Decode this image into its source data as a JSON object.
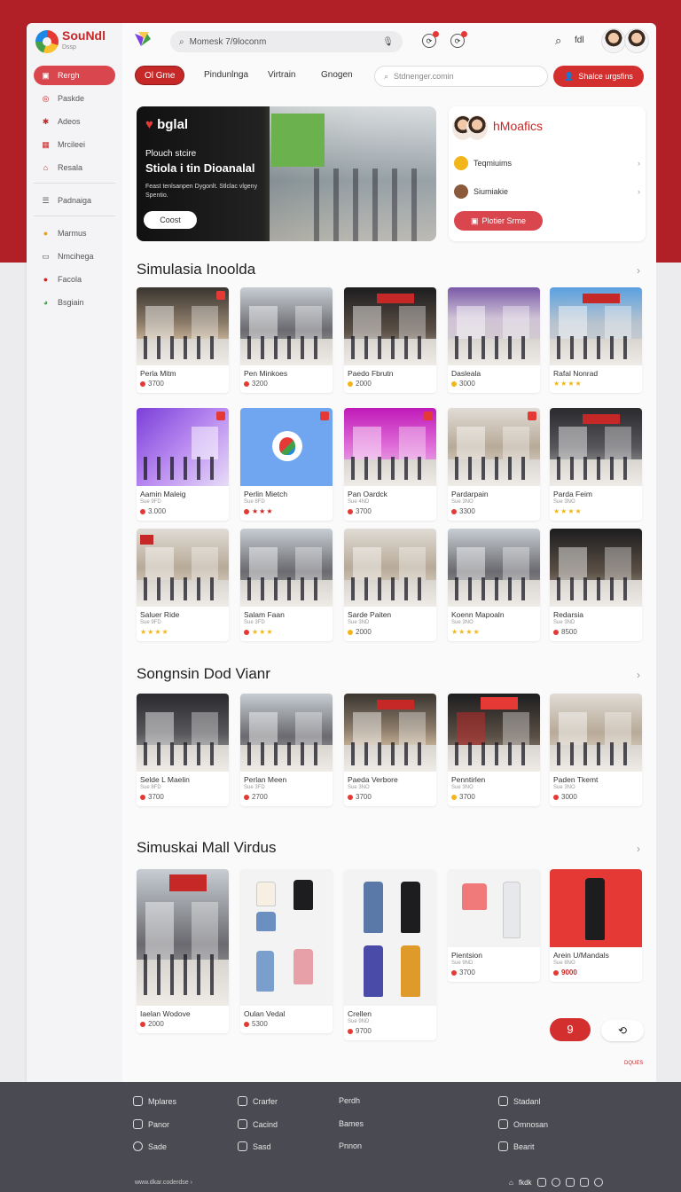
{
  "sidebar": {
    "logo": {
      "name": "SouNdl",
      "sub": "Dssp"
    },
    "items": [
      {
        "label": "Rergh",
        "icon": "home-icon",
        "active": true
      },
      {
        "label": "Paskde",
        "icon": "tag-icon",
        "active": false
      },
      {
        "label": "Adeos",
        "icon": "puzzle-icon",
        "active": false
      },
      {
        "label": "Mrcileei",
        "icon": "grid-icon",
        "active": false
      },
      {
        "label": "Resala",
        "icon": "store-icon",
        "active": false
      },
      {
        "label": "Padnaiga",
        "icon": "list-icon",
        "active": false
      },
      {
        "label": "Marmus",
        "icon": "circle-icon",
        "active": false
      },
      {
        "label": "Nmcihega",
        "icon": "box-icon",
        "active": false
      },
      {
        "label": "Facola",
        "icon": "red-dot-icon",
        "active": false
      },
      {
        "label": "Bsgiain",
        "icon": "leaf-icon",
        "active": false
      }
    ]
  },
  "topbar": {
    "search_value": "Momesk 7/9loconm",
    "right_label": "fdl"
  },
  "filters": {
    "chips": [
      "Ol Gme",
      "Pindunlnga",
      "Virtrain",
      "Gnogen"
    ],
    "search_placeholder": "Stdnenger.comin",
    "cta": "Shalce urgsfins"
  },
  "hero": {
    "logo": "bglal",
    "kicker": "Plouch stcire",
    "title": "Stiola i tin Dioanalal",
    "desc": "Feast tenlsanpen Dygonlt. Stlclac vlgeny Spentio.",
    "button": "Coost"
  },
  "promo": {
    "title": "hMoafics",
    "rows": [
      "Teqmiuims",
      "Siumiakie"
    ],
    "button": "Plotier Srme"
  },
  "sections": [
    {
      "title": "Simulasia Inoolda"
    },
    {
      "title": "Songnsin Dod Vianr"
    },
    {
      "title": "Simuskai Mall Virdus"
    }
  ],
  "grid1": [
    {
      "title": "Perla Mitm",
      "sub": "",
      "price": "3700",
      "kind": "price"
    },
    {
      "title": "Pen Minkoes",
      "sub": "",
      "price": "3200",
      "kind": "price"
    },
    {
      "title": "Paedo Fbrutn",
      "sub": "",
      "price": "2000",
      "kind": "price"
    },
    {
      "title": "Dasleala",
      "sub": "",
      "price": "3000",
      "kind": "price"
    },
    {
      "title": "Rafal Nonrad",
      "sub": "",
      "price": "★★★★",
      "kind": "star"
    },
    {
      "title": "Aamin Maleig",
      "sub": "Sue 9FD",
      "price": "3.000",
      "kind": "price"
    },
    {
      "title": "Perlin Mietch",
      "sub": "Sue 8FD",
      "price": "★★★",
      "kind": "star"
    },
    {
      "title": "Pan Oardck",
      "sub": "Sue 4ND",
      "price": "3700",
      "kind": "price"
    },
    {
      "title": "Pardarpain",
      "sub": "Sue 3NO",
      "price": "3300",
      "kind": "price"
    },
    {
      "title": "Parda Feim",
      "sub": "Sue 3NO",
      "price": "★★★★",
      "kind": "star"
    },
    {
      "title": "Saluer Ride",
      "sub": "Sue 9FD",
      "price": "★★★★",
      "kind": "star"
    },
    {
      "title": "Salam Faan",
      "sub": "Sue 3FD",
      "price": "★★★",
      "kind": "star"
    },
    {
      "title": "Sarde Paiten",
      "sub": "Sue 3ND",
      "price": "2000",
      "kind": "price"
    },
    {
      "title": "Koenn Mapoaln",
      "sub": "Sue 3NO",
      "price": "★★★★",
      "kind": "star"
    },
    {
      "title": "Redarsia",
      "sub": "Sue 3ND",
      "price": "8500",
      "kind": "price"
    }
  ],
  "grid2": [
    {
      "title": "Selde L Maelin",
      "sub": "Sue 8FD",
      "price": "3700",
      "kind": "price"
    },
    {
      "title": "Perlan Meen",
      "sub": "Sue 3FD",
      "price": "2700",
      "kind": "price"
    },
    {
      "title": "Paeda Verbore",
      "sub": "Sue 3NO",
      "price": "3700",
      "kind": "price"
    },
    {
      "title": "Penntirlen",
      "sub": "Sue 3NO",
      "price": "3700",
      "kind": "price"
    },
    {
      "title": "Paden Tkemt",
      "sub": "Sue 3NO",
      "price": "3000",
      "kind": "price"
    }
  ],
  "grid3": [
    {
      "title": "Iaelan Wodove",
      "sub": "",
      "price": "2000",
      "kind": "price"
    },
    {
      "title": "Oulan Vedal",
      "sub": "",
      "price": "5300",
      "kind": "price"
    },
    {
      "title": "Crellen",
      "sub": "Sue 9ND",
      "price": "9700",
      "kind": "price"
    },
    {
      "title": "Pientsion",
      "sub": "Sue 9ND",
      "price": "3700",
      "kind": "price"
    },
    {
      "title": "Arein U/Mandals",
      "sub": "Sue 8NO",
      "price": "9000",
      "kind": "price-red"
    }
  ],
  "pager": {
    "page": "9"
  },
  "note": "DQUES",
  "footer": {
    "col1": [
      "Mplares",
      "Panor",
      "Sade"
    ],
    "col2": [
      "Crarfer",
      "Cacind",
      "Sasd"
    ],
    "col3": [
      "Perdh",
      "Bames",
      "Pnnon"
    ],
    "col4": [
      "Stadanl",
      "Omnosan",
      "Bearit"
    ],
    "bottom_left": "www.dkar.coderdse",
    "bottom_right": "fkdk"
  },
  "colors": {
    "brand": "#c62828",
    "accent": "#d32f2f",
    "footer": "#4a4a52"
  }
}
